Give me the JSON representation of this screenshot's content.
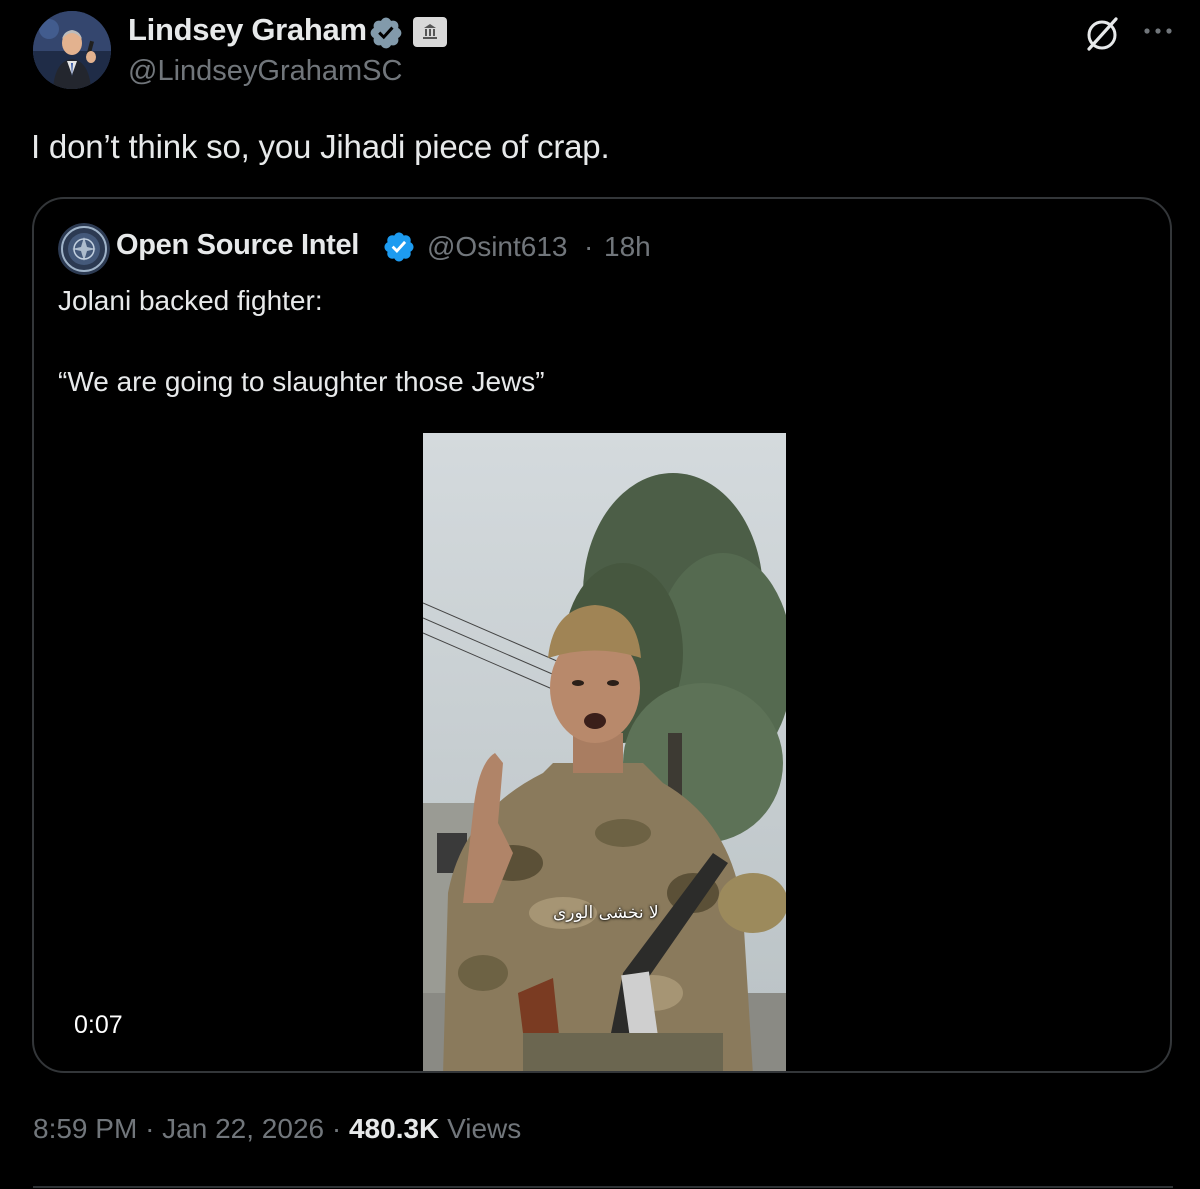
{
  "tweet": {
    "author": {
      "name": "Lindsey Graham",
      "handle": "@LindseyGrahamSC",
      "verified_badge": "gray-verified-badge-icon",
      "affiliation_badge": "government-building-icon"
    },
    "text": "I don’t think so, you Jihadi piece of crap.",
    "header_icons": [
      "grok-icon",
      "more-options-icon"
    ],
    "quote": {
      "author": {
        "name": "Open Source Intel",
        "handle": "@Osint613",
        "verified_badge": "blue-verified-badge-icon"
      },
      "separator": "·",
      "time": "18h",
      "text_line1": "Jolani backed fighter:",
      "text_line2": "“We are going to slaughter those Jews”",
      "video": {
        "duration": "0:07",
        "subtitle": "لا نخشى الورى"
      }
    },
    "meta": {
      "time": "8:59 PM",
      "sep1": "·",
      "date": "Jan 22, 2026",
      "sep2": "·",
      "views_count": "480.3K",
      "views_label": "Views"
    }
  },
  "colors": {
    "background": "#000000",
    "text_primary": "#e7e9ea",
    "text_secondary": "#71767b",
    "border": "#333639",
    "verified_blue": "#1d9bf0",
    "verified_gray": "#829aab"
  }
}
